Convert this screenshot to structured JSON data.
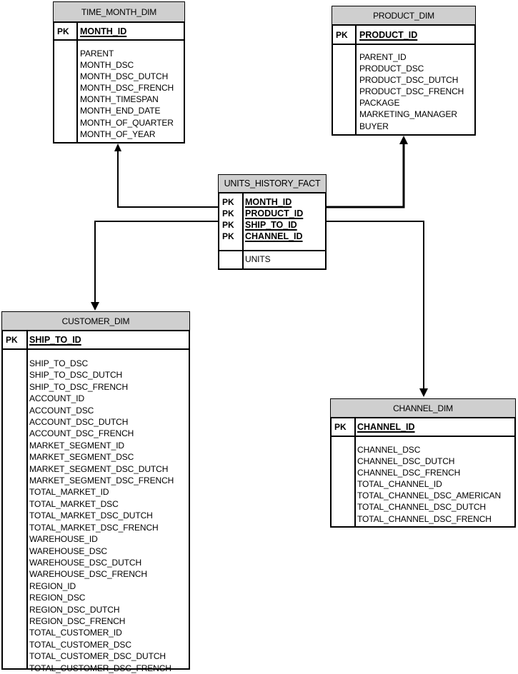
{
  "diagram": {
    "type": "star-schema",
    "entities": [
      {
        "id": "time_month_dim",
        "name": "TIME_MONTH_DIM",
        "pk_label": "PK",
        "primary_keys": [
          "MONTH_ID"
        ],
        "attributes": [
          "PARENT",
          "MONTH_DSC",
          "MONTH_DSC_DUTCH",
          "MONTH_DSC_FRENCH",
          "MONTH_TIMESPAN",
          "MONTH_END_DATE",
          "MONTH_OF_QUARTER",
          "MONTH_OF_YEAR"
        ]
      },
      {
        "id": "product_dim",
        "name": "PRODUCT_DIM",
        "pk_label": "PK",
        "primary_keys": [
          "PRODUCT_ID"
        ],
        "attributes": [
          "PARENT_ID",
          "PRODUCT_DSC",
          "PRODUCT_DSC_DUTCH",
          "PRODUCT_DSC_FRENCH",
          "PACKAGE",
          "MARKETING_MANAGER",
          "BUYER"
        ]
      },
      {
        "id": "units_history_fact",
        "name": "UNITS_HISTORY_FACT",
        "pk_label": "PK",
        "primary_keys": [
          "MONTH_ID",
          "PRODUCT_ID",
          "SHIP_TO_ID",
          "CHANNEL_ID"
        ],
        "attributes": [
          "UNITS"
        ]
      },
      {
        "id": "customer_dim",
        "name": "CUSTOMER_DIM",
        "pk_label": "PK",
        "primary_keys": [
          "SHIP_TO_ID"
        ],
        "attributes": [
          "SHIP_TO_DSC",
          "SHIP_TO_DSC_DUTCH",
          "SHIP_TO_DSC_FRENCH",
          "ACCOUNT_ID",
          "ACCOUNT_DSC",
          "ACCOUNT_DSC_DUTCH",
          "ACCOUNT_DSC_FRENCH",
          "MARKET_SEGMENT_ID",
          "MARKET_SEGMENT_DSC",
          "MARKET_SEGMENT_DSC_DUTCH",
          "MARKET_SEGMENT_DSC_FRENCH",
          "TOTAL_MARKET_ID",
          "TOTAL_MARKET_DSC",
          "TOTAL_MARKET_DSC_DUTCH",
          "TOTAL_MARKET_DSC_FRENCH",
          "WAREHOUSE_ID",
          "WAREHOUSE_DSC",
          "WAREHOUSE_DSC_DUTCH",
          "WAREHOUSE_DSC_FRENCH",
          "REGION_ID",
          "REGION_DSC",
          "REGION_DSC_DUTCH",
          "REGION_DSC_FRENCH",
          "TOTAL_CUSTOMER_ID",
          "TOTAL_CUSTOMER_DSC",
          "TOTAL_CUSTOMER_DSC_DUTCH",
          "TOTAL_CUSTOMER_DSC_FRENCH"
        ]
      },
      {
        "id": "channel_dim",
        "name": "CHANNEL_DIM",
        "pk_label": "PK",
        "primary_keys": [
          "CHANNEL_ID"
        ],
        "attributes": [
          "CHANNEL_DSC",
          "CHANNEL_DSC_DUTCH",
          "CHANNEL_DSC_FRENCH",
          "TOTAL_CHANNEL_ID",
          "TOTAL_CHANNEL_DSC_AMERICAN",
          "TOTAL_CHANNEL_DSC_DUTCH",
          "TOTAL_CHANNEL_DSC_FRENCH"
        ]
      }
    ],
    "relationships": [
      {
        "from": "units_history_fact",
        "to": "time_month_dim",
        "key": "MONTH_ID"
      },
      {
        "from": "units_history_fact",
        "to": "product_dim",
        "key": "PRODUCT_ID"
      },
      {
        "from": "units_history_fact",
        "to": "customer_dim",
        "key": "SHIP_TO_ID"
      },
      {
        "from": "units_history_fact",
        "to": "channel_dim",
        "key": "CHANNEL_ID"
      }
    ],
    "colors": {
      "header_fill": "#cfcfcf",
      "line": "#000000",
      "background": "#ffffff"
    }
  }
}
